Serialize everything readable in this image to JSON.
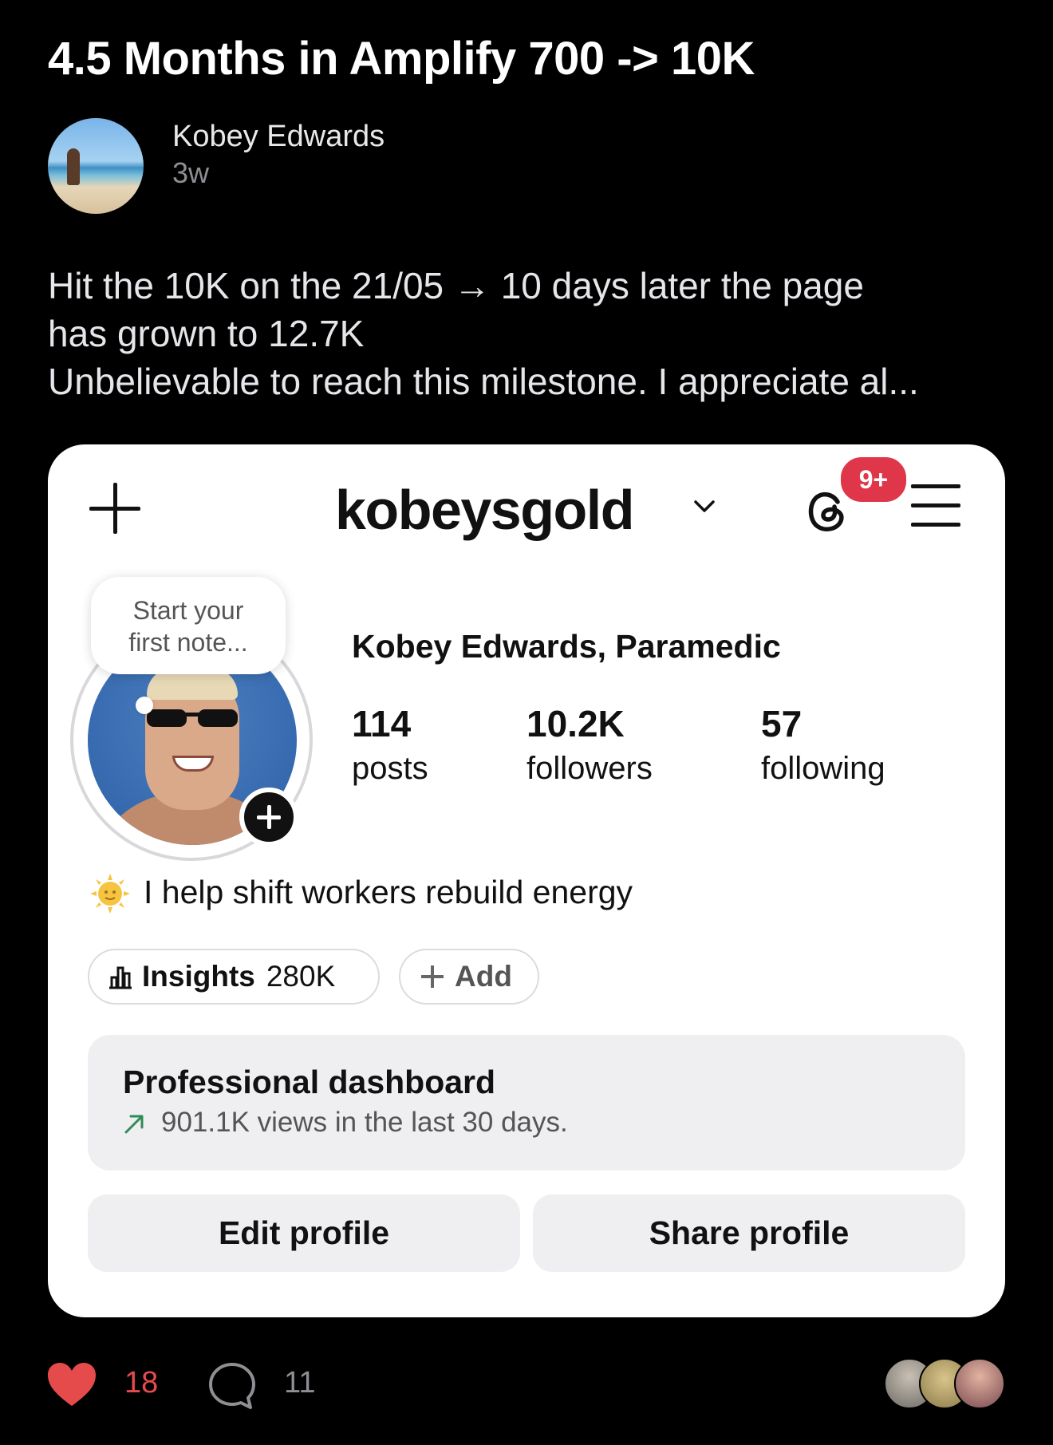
{
  "post": {
    "title": "4.5 Months in Amplify 700 -> 10K",
    "author": "Kobey Edwards",
    "time": "3w",
    "body_lines": [
      "Hit the 10K on the 21/05 → 10 days later the page",
      "has grown to 12.7K",
      "Unbelievable to reach this milestone. I appreciate al..."
    ]
  },
  "profile": {
    "username": "kobeysgold",
    "notif_badge": "9+",
    "note_lines": [
      "Start your",
      "first note..."
    ],
    "display_name": "Kobey Edwards, Paramedic",
    "stats": [
      {
        "value": "114",
        "label": "posts"
      },
      {
        "value": "10.2K",
        "label": "followers"
      },
      {
        "value": "57",
        "label": "following"
      }
    ],
    "bio": "I help shift workers rebuild energy",
    "bio_icon": "sun-with-face-emoji",
    "insights_label": "Insights",
    "insights_value": "280K",
    "add_label": "Add",
    "dashboard_title": "Professional dashboard",
    "dashboard_sub": "901.1K views in the last 30 days.",
    "edit_button": "Edit profile",
    "share_button": "Share profile"
  },
  "footer": {
    "likes": "18",
    "comments": "11",
    "like_color": "#e64b4b"
  }
}
